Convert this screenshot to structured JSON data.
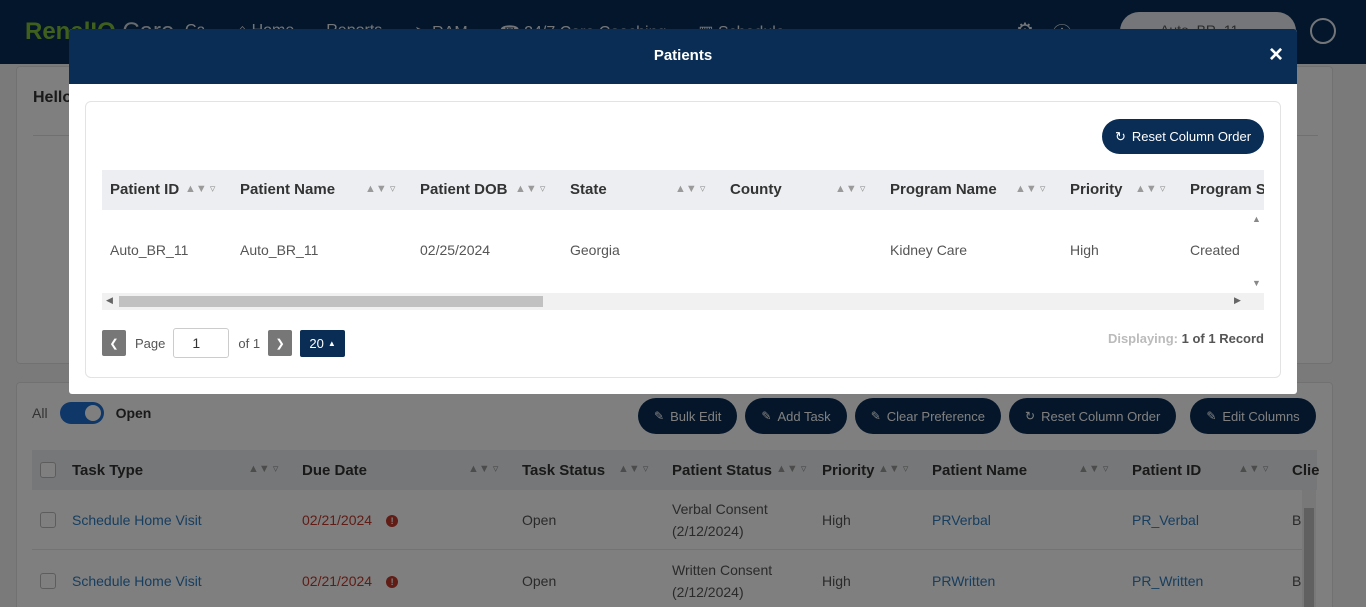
{
  "app": {
    "brand_left": "RenalIQ",
    "brand_right": "Care",
    "nav": [
      "Ca",
      "Home",
      "Reports",
      "RAM",
      "24/7 Care Coaching",
      "Schedule"
    ],
    "search_value": "Auto_BR_11"
  },
  "dashboard": {
    "greeting": "Hello",
    "toggle": {
      "left_label": "All",
      "right_label": "Open"
    },
    "actions": [
      "Bulk Edit",
      "Add Task",
      "Clear Preference",
      "Reset Column Order",
      "Edit Columns"
    ],
    "columns": [
      "Task Type",
      "Due Date",
      "Task Status",
      "Patient Status",
      "Priority",
      "Patient Name",
      "Patient ID",
      "Clie"
    ],
    "rows": [
      {
        "task_type": "Schedule Home Visit",
        "due_date": "02/21/2024",
        "task_status": "Open",
        "patient_status_1": "Verbal Consent",
        "patient_status_2": "(2/12/2024)",
        "priority": "High",
        "patient_name": "PRVerbal",
        "patient_id": "PR_Verbal",
        "client": "B"
      },
      {
        "task_type": "Schedule Home Visit",
        "due_date": "02/21/2024",
        "task_status": "Open",
        "patient_status_1": "Written Consent",
        "patient_status_2": "(2/12/2024)",
        "priority": "High",
        "patient_name": "PRWritten",
        "patient_id": "PR_Written",
        "client": "B"
      }
    ]
  },
  "modal": {
    "title": "Patients",
    "close": "×",
    "reset_label": "Reset Column Order",
    "columns": [
      "Patient ID",
      "Patient Name",
      "Patient DOB",
      "State",
      "County",
      "Program Name",
      "Priority",
      "Program S"
    ],
    "row": {
      "patient_id": "Auto_BR_11",
      "patient_name": "Auto_BR_11",
      "dob": "02/25/2024",
      "state": "Georgia",
      "county": "",
      "program_name": "Kidney Care",
      "priority": "High",
      "program_status": "Created"
    },
    "pager": {
      "page_label": "Page",
      "page_value": "1",
      "of_label": "of 1",
      "page_size": "20",
      "displaying_label": "Displaying:",
      "displaying_value": "1 of 1 Record"
    }
  }
}
